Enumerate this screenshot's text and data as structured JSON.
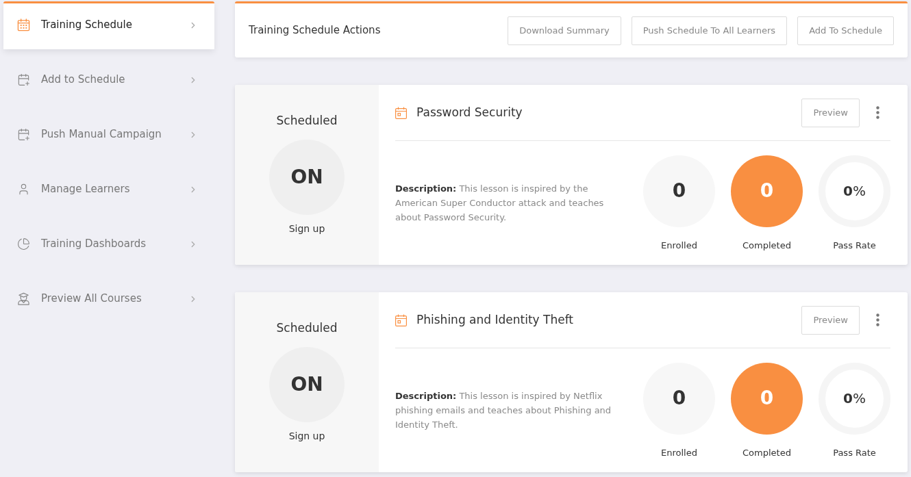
{
  "sidebar": {
    "items": [
      {
        "label": "Training Schedule",
        "selected": true
      },
      {
        "label": "Add to Schedule",
        "selected": false
      },
      {
        "label": "Push Manual Campaign",
        "selected": false
      },
      {
        "label": "Manage Learners",
        "selected": false
      },
      {
        "label": "Training Dashboards",
        "selected": false
      },
      {
        "label": "Preview All Courses",
        "selected": false
      }
    ]
  },
  "actions_bar": {
    "title": "Training Schedule Actions",
    "buttons": [
      "Download Summary",
      "Push Schedule To All Learners",
      "Add To Schedule"
    ]
  },
  "courses": [
    {
      "status": "Scheduled",
      "toggle": "ON",
      "toggle_caption": "Sign up",
      "title": "Password Security",
      "preview_button": "Preview",
      "description": "**Description:** This lesson is inspired by the American Super Conductor attack and teaches about Password Security.",
      "stats": [
        {
          "kind": "count",
          "value": "0",
          "label": "Enrolled"
        },
        {
          "kind": "highlight",
          "value": "0",
          "label": "Completed"
        },
        {
          "kind": "ring",
          "value": "**0**%",
          "label": "Pass Rate"
        }
      ]
    },
    {
      "status": "Scheduled",
      "toggle": "ON",
      "toggle_caption": "Sign up",
      "title": "Phishing and Identity Theft",
      "preview_button": "Preview",
      "description": "**Description:** This lesson is inspired by Netflix phishing emails and teaches about Phishing and Identity Theft.",
      "stats": [
        {
          "kind": "count",
          "value": "0",
          "label": "Enrolled"
        },
        {
          "kind": "highlight",
          "value": "0",
          "label": "Completed"
        },
        {
          "kind": "ring",
          "value": "**0**%",
          "label": "Pass Rate"
        }
      ]
    }
  ]
}
